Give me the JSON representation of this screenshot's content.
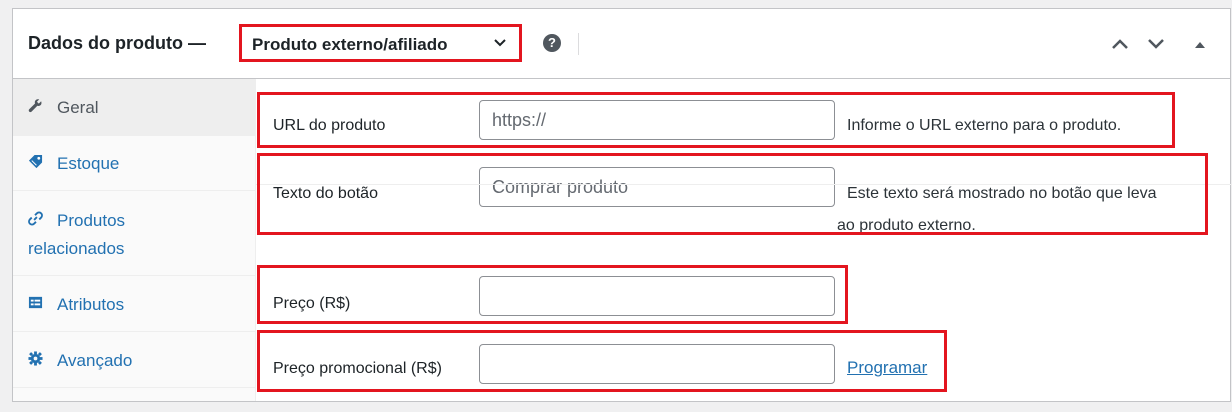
{
  "header": {
    "title": "Dados do produto —",
    "product_type": "Produto externo/afiliado",
    "help_icon": "question-circle-icon",
    "buttons": [
      "chevron-up-icon",
      "chevron-down-icon",
      "triangle-up-icon"
    ]
  },
  "sidebar": {
    "tabs": [
      {
        "label": "Geral",
        "icon": "wrench-icon",
        "active": true
      },
      {
        "label": "Estoque",
        "icon": "tag-icon"
      },
      {
        "label_line1": "Produtos",
        "label_line2": "relacionados",
        "icon": "link-icon"
      },
      {
        "label": "Atributos",
        "icon": "list-card-icon"
      },
      {
        "label": "Avançado",
        "icon": "gear-icon"
      }
    ]
  },
  "fields": {
    "url": {
      "label": "URL do produto",
      "placeholder": "https://",
      "description": "Informe o URL externo para o produto."
    },
    "button_text": {
      "label": "Texto do botão",
      "placeholder": "Comprar produto",
      "description_line1": "Este texto será mostrado no botão que leva",
      "description_line2": "ao produto externo."
    },
    "price": {
      "label": "Preço (R$)",
      "value": ""
    },
    "sale_price": {
      "label": "Preço promocional (R$)",
      "value": "",
      "schedule_link": "Programar"
    }
  },
  "colors": {
    "highlight": "#e3151f",
    "link": "#2271b1"
  }
}
